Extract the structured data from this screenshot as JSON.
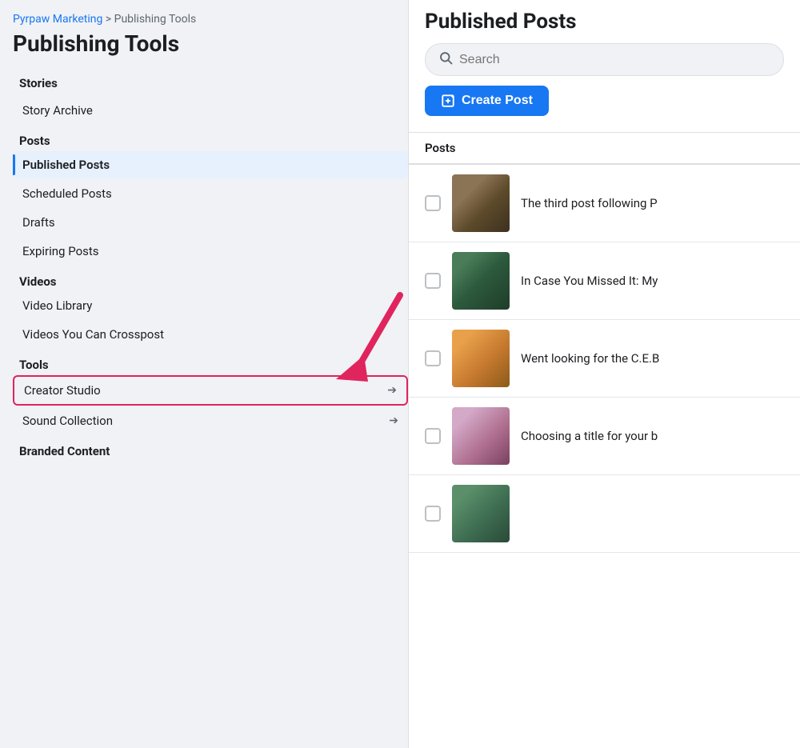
{
  "breadcrumb": {
    "brand": "Pyrpaw Marketing",
    "separator": " > ",
    "current": "Publishing Tools"
  },
  "page_title": "Publishing Tools",
  "sidebar": {
    "sections": [
      {
        "label": "Stories",
        "items": [
          {
            "id": "story-archive",
            "label": "Story Archive",
            "active": false,
            "external": false,
            "highlighted": false
          }
        ]
      },
      {
        "label": "Posts",
        "items": [
          {
            "id": "published-posts",
            "label": "Published Posts",
            "active": true,
            "external": false,
            "highlighted": false
          },
          {
            "id": "scheduled-posts",
            "label": "Scheduled Posts",
            "active": false,
            "external": false,
            "highlighted": false
          },
          {
            "id": "drafts",
            "label": "Drafts",
            "active": false,
            "external": false,
            "highlighted": false
          },
          {
            "id": "expiring-posts",
            "label": "Expiring Posts",
            "active": false,
            "external": false,
            "highlighted": false
          }
        ]
      },
      {
        "label": "Videos",
        "items": [
          {
            "id": "video-library",
            "label": "Video Library",
            "active": false,
            "external": false,
            "highlighted": false
          },
          {
            "id": "videos-crosspost",
            "label": "Videos You Can Crosspost",
            "active": false,
            "external": false,
            "highlighted": false
          }
        ]
      },
      {
        "label": "Tools",
        "items": [
          {
            "id": "creator-studio",
            "label": "Creator Studio",
            "active": false,
            "external": true,
            "highlighted": true
          },
          {
            "id": "sound-collection",
            "label": "Sound Collection",
            "active": false,
            "external": true,
            "highlighted": false
          }
        ]
      },
      {
        "label": "Branded Content",
        "items": []
      }
    ]
  },
  "main": {
    "title": "Published Posts",
    "search": {
      "placeholder": "Search"
    },
    "create_post_label": "Create Post",
    "table_header": "Posts",
    "posts": [
      {
        "id": "post-1",
        "text": "The third post following P",
        "thumb_class": "thumb-1"
      },
      {
        "id": "post-2",
        "text": "In Case You Missed It: My",
        "thumb_class": "thumb-2"
      },
      {
        "id": "post-3",
        "text": "Went looking for the C.E.B",
        "thumb_class": "thumb-3"
      },
      {
        "id": "post-4",
        "text": "Choosing a title for your b",
        "thumb_class": "thumb-4"
      },
      {
        "id": "post-5",
        "text": "",
        "thumb_class": "thumb-5"
      }
    ]
  },
  "colors": {
    "accent_blue": "#1877f2",
    "accent_pink": "#e0245e",
    "active_nav_bg": "#e7f0fd"
  }
}
